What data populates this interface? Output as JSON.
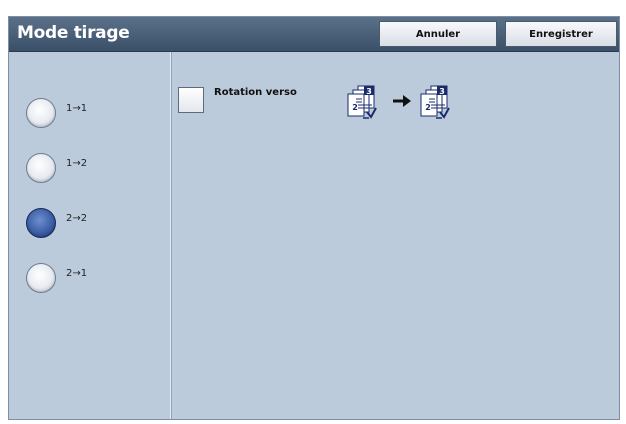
{
  "header": {
    "title": "Mode tirage",
    "cancel_label": "Annuler",
    "save_label": "Enregistrer"
  },
  "options": [
    {
      "label": "1→1",
      "selected": false
    },
    {
      "label": "1→2",
      "selected": false
    },
    {
      "label": "2→2",
      "selected": true
    },
    {
      "label": "2→1",
      "selected": false
    }
  ],
  "rotation": {
    "label": "Rotation verso",
    "checked": false
  },
  "diagram": {
    "page_number": "3",
    "arrow": "→"
  },
  "colors": {
    "titlebar": "#3a5068",
    "panel": "#bccbdc",
    "selected_radio": "#3e5fa6"
  }
}
